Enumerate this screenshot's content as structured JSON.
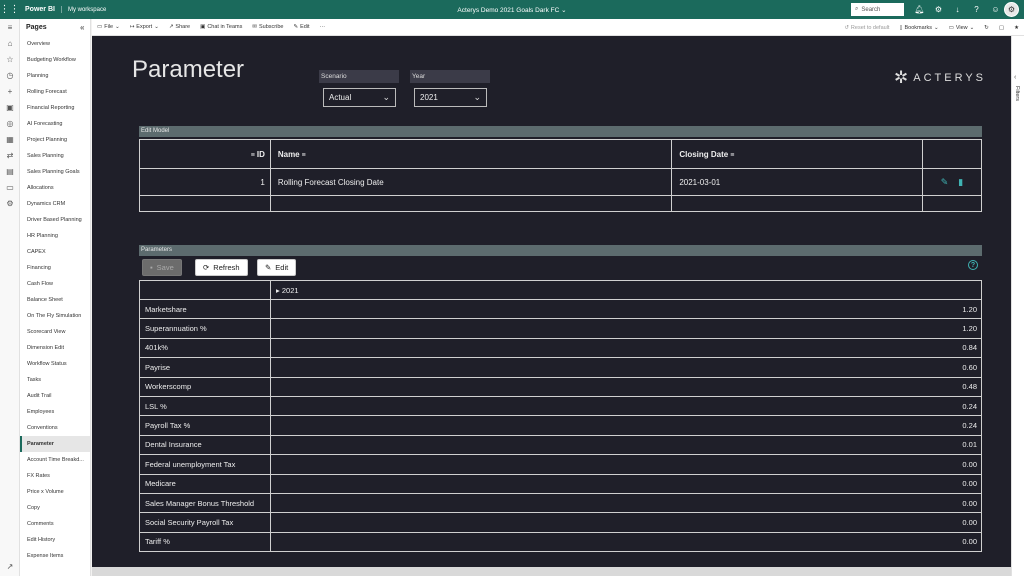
{
  "topbar": {
    "brand": "Power BI",
    "workspace": "My workspace",
    "doc_title": "Acterys Demo 2021 Goals Dark FC",
    "search_placeholder": "Search"
  },
  "pages_pane": {
    "title": "Pages",
    "items": [
      "Overview",
      "Budgeting Workflow",
      "Planning",
      "Rolling Forecast",
      "Financial Reporting",
      "AI Forecasting",
      "Project Planning",
      "Sales Planning",
      "Sales Planning Goals",
      "Allocations",
      "Dynamics CRM",
      "Driver Based Planning",
      "HR Planning",
      "CAPEX",
      "Financing",
      "Cash Flow",
      "Balance Sheet",
      "On The Fly Simulation",
      "Scorecard View",
      "Dimension Edit",
      "Workflow Status",
      "Tasks",
      "Audit Trail",
      "Employees",
      "Conventions",
      "Parameter",
      "Account Time Breakd...",
      "FX Rates",
      "Price x Volume",
      "Copy",
      "Comments",
      "Edit History",
      "Expense Items"
    ],
    "active": "Parameter"
  },
  "toolbar": {
    "file": "File",
    "export": "Export",
    "share": "Share",
    "chat": "Chat in Teams",
    "subscribe": "Subscribe",
    "edit": "Edit",
    "reset": "Reset to default",
    "bookmarks": "Bookmarks",
    "view": "View"
  },
  "filters_label": "Filters",
  "report": {
    "title": "Parameter",
    "scenario": {
      "label": "Scenario",
      "value": "Actual"
    },
    "year": {
      "label": "Year",
      "value": "2021"
    },
    "logo_text": "ACTERYS",
    "edit_model": {
      "section": "Edit Model",
      "headers": {
        "id": "ID",
        "name": "Name",
        "closing_date": "Closing Date"
      },
      "rows": [
        {
          "id": "1",
          "name": "Rolling Forecast Closing Date",
          "closing_date": "2021-03-01"
        }
      ]
    },
    "parameters": {
      "section": "Parameters",
      "save": "Save",
      "refresh": "Refresh",
      "edit": "Edit",
      "column": "2021",
      "rows": [
        {
          "name": "Marketshare",
          "value": "1.20"
        },
        {
          "name": "Superannuation %",
          "value": "1.20"
        },
        {
          "name": "401k%",
          "value": "0.84"
        },
        {
          "name": "Payrise",
          "value": "0.60"
        },
        {
          "name": "Workerscomp",
          "value": "0.48"
        },
        {
          "name": "LSL %",
          "value": "0.24"
        },
        {
          "name": "Payroll Tax %",
          "value": "0.24"
        },
        {
          "name": "Dental Insurance",
          "value": "0.01"
        },
        {
          "name": "Federal unemployment Tax",
          "value": "0.00"
        },
        {
          "name": "Medicare",
          "value": "0.00"
        },
        {
          "name": "Sales Manager Bonus Threshold",
          "value": "0.00"
        },
        {
          "name": "Social Security Payroll Tax",
          "value": "0.00"
        },
        {
          "name": "Tariff %",
          "value": "0.00"
        }
      ]
    }
  }
}
